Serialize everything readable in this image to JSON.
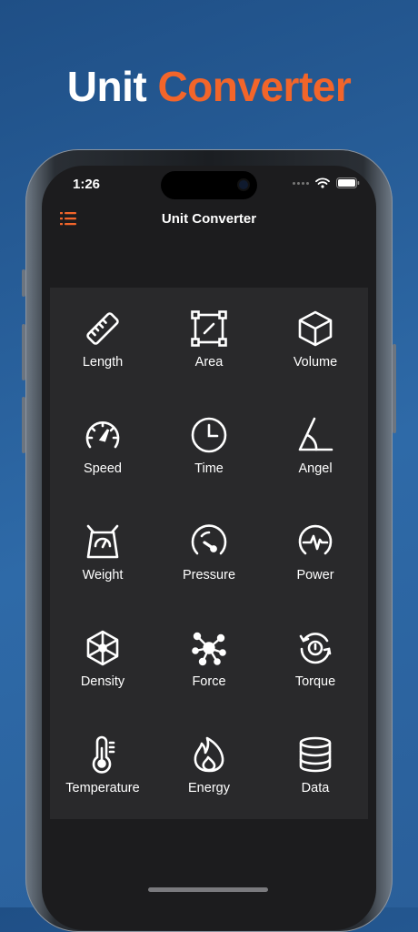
{
  "promo": {
    "title_part1": "Unit",
    "title_part2": "Converter",
    "accent": "#f2652a"
  },
  "status_bar": {
    "time": "1:26"
  },
  "nav": {
    "title": "Unit Converter",
    "menu_icon": "list-icon"
  },
  "categories": [
    {
      "label": "Length",
      "icon": "ruler-icon"
    },
    {
      "label": "Area",
      "icon": "area-icon"
    },
    {
      "label": "Volume",
      "icon": "cube-icon"
    },
    {
      "label": "Speed",
      "icon": "speedometer-icon"
    },
    {
      "label": "Time",
      "icon": "clock-icon"
    },
    {
      "label": "Angel",
      "icon": "angle-icon"
    },
    {
      "label": "Weight",
      "icon": "scale-icon"
    },
    {
      "label": "Pressure",
      "icon": "gauge-icon"
    },
    {
      "label": "Power",
      "icon": "power-icon"
    },
    {
      "label": "Density",
      "icon": "density-icon"
    },
    {
      "label": "Force",
      "icon": "force-icon"
    },
    {
      "label": "Torque",
      "icon": "torque-icon"
    },
    {
      "label": "Temperature",
      "icon": "thermometer-icon"
    },
    {
      "label": "Energy",
      "icon": "flame-icon"
    },
    {
      "label": "Data",
      "icon": "database-icon"
    }
  ]
}
